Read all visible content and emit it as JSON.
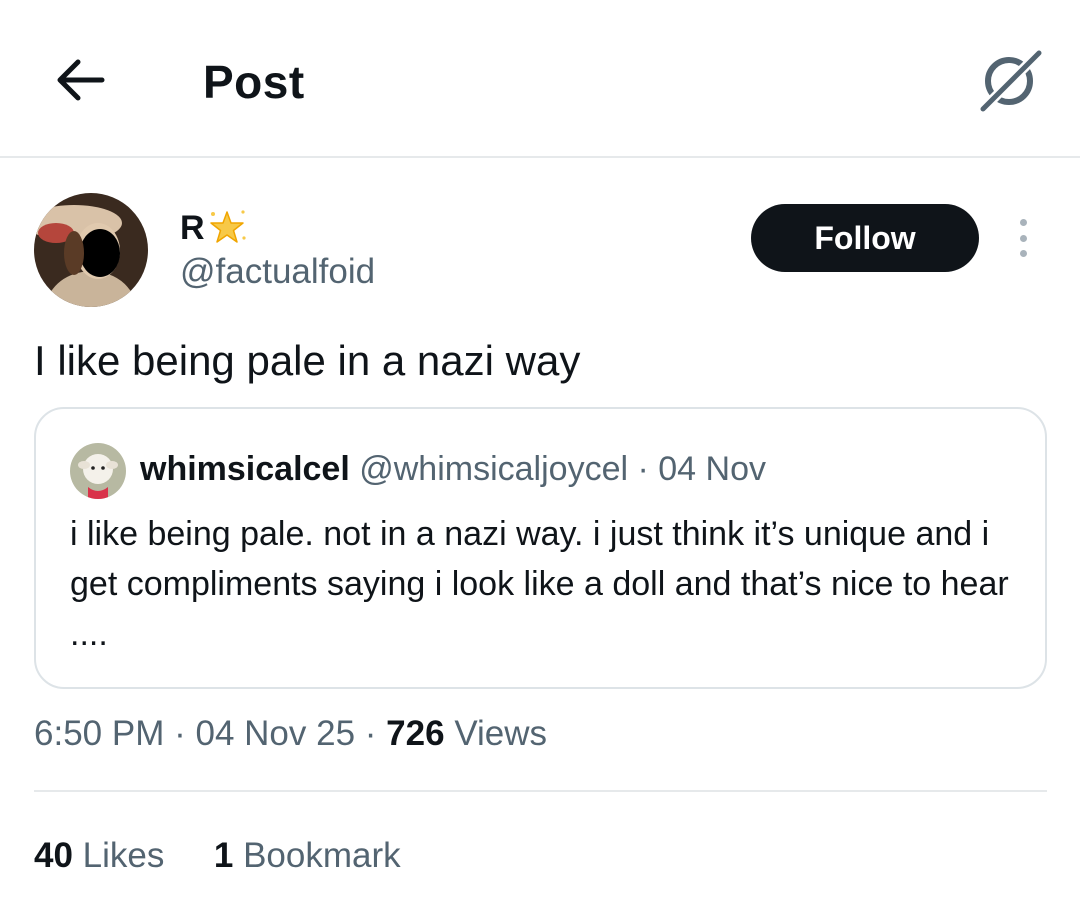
{
  "header": {
    "title": "Post",
    "back_icon": "arrow-left-icon",
    "grok_icon": "grok-icon"
  },
  "author": {
    "name": "R",
    "name_emoji": "star-icon",
    "handle": "@factualfoid",
    "follow_label": "Follow"
  },
  "post": {
    "text": "I like being pale in a nazi way"
  },
  "quote": {
    "name": "whimsicalcel",
    "handle": "@whimsicaljoycel",
    "separator": "·",
    "date": "04 Nov",
    "text": "i like being pale. not in a nazi way. i just think it’s unique and i get compliments saying i look like a doll and that’s nice to hear ...."
  },
  "meta": {
    "time": "6:50 PM",
    "date": "04 Nov 25",
    "separator": "·",
    "views_count": "726",
    "views_label": "Views"
  },
  "stats": {
    "likes_count": "40",
    "likes_label": "Likes",
    "bookmarks_count": "1",
    "bookmarks_label": "Bookmark"
  },
  "colors": {
    "text_primary": "#0f1419",
    "text_secondary": "#536471",
    "border": "#dde3e7",
    "follow_bg": "#0f1419"
  }
}
